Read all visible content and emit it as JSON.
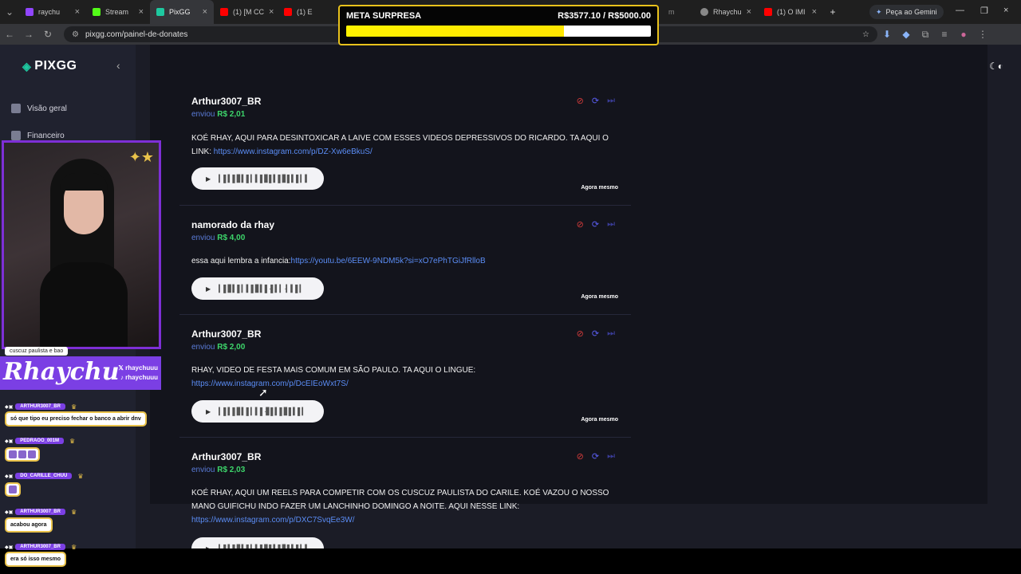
{
  "browser": {
    "tabs": [
      {
        "label": "raychu",
        "color": "#9146ff"
      },
      {
        "label": "Stream",
        "color": "#53fc18"
      },
      {
        "label": "PixGG",
        "color": "#1ec8a0"
      },
      {
        "label": "(1) [M CC",
        "color": "#ff0000"
      },
      {
        "label": "(1) E",
        "color": "#ff0000"
      },
      {
        "label": "Rhaychu",
        "color": "#888888"
      },
      {
        "label": "(1) O IMI",
        "color": "#ff0000"
      }
    ],
    "url": "pixgg.com/painel-de-donates",
    "gemini_label": "Peça ao Gemini"
  },
  "goal": {
    "title": "META SURPRESA",
    "amount_text": "R$3577.10 / R$5000.00",
    "progress": 0.7154
  },
  "app": {
    "logo": "PIXGG",
    "nav": [
      {
        "label": "Visão geral"
      },
      {
        "label": "Financeiro"
      }
    ]
  },
  "donations": [
    {
      "name": "Arthur3007_BR",
      "sent_label": "enviou",
      "amount": "R$ 2,01",
      "message": "KOÉ RHAY, AQUI PARA DESINTOXICAR A LAIVE COM ESSES VIDEOS DEPRESSIVOS DO RICARDO. TA AQUI O LINK: ",
      "link": "https://www.instagram.com/p/DZ-Xw6eBkuS/",
      "waveform": "▎▌▍▌▋▍▌▎▍▌▋▌▍▌▋▌▍▌▎▍",
      "time": "Agora mesmo"
    },
    {
      "name": "namorado da rhay",
      "sent_label": "enviou",
      "amount": "R$ 4,00",
      "message": "essa aqui lembra a infancia:",
      "link": "https://youtu.be/6EEW-9NDM5k?si=xO7ePhTGiJfRlloB",
      "waveform": "▎▌▋▍▌▎▍▌▋▍▌·▌▍▎·▎▍▌▎",
      "time": "Agora mesmo"
    },
    {
      "name": "Arthur3007_BR",
      "sent_label": "enviou",
      "amount": "R$ 2,00",
      "message": "RHAY, VIDEO DE FESTA MAIS COMUM EM SÃO PAULO. TA AQUI O LINGUE: ",
      "link": "https://www.instagram.com/p/DcEIEoWxt7S/",
      "waveform": "▎▌▍▌▋▍▌▎▍▌·▋▌▍▌▋▌▍▌▎",
      "time": "Agora mesmo"
    },
    {
      "name": "Arthur3007_BR",
      "sent_label": "enviou",
      "amount": "R$ 2,03",
      "message": "KOÉ RHAY, AQUI UM REELS PARA COMPETIR COM OS CUSCUZ PAULISTA DO CARILE. KOÉ VAZOU O NOSSO MANO GUIFICHU INDO FAZER UM LANCHINHO DOMINGO A NOITE. AQUI NESSE LINK: ",
      "link": "https://www.instagram.com/p/DXC7SvqEe3W/",
      "waveform": "▎▌▍▌▋▍▌▎▍▌▋▌▍▌▋▌▍▌▎▍",
      "time": ""
    }
  ],
  "stream_overlay": {
    "brand_name": "Rhaychu",
    "handle_x": "rhaychuuu",
    "handle_tiktok": "rhaychuuu",
    "top_pill": "cuscuz paulista e bao",
    "chat": [
      {
        "user": "ARTHUR3007_BR",
        "message": "só que tipo eu preciso fechar o banco a abrir dnv"
      },
      {
        "user": "PEDRAOO_001M",
        "message": ""
      },
      {
        "user": "DO_CARILLE_CHUU",
        "message": ""
      },
      {
        "user": "ARTHUR3007_BR",
        "message": "acabou agora"
      },
      {
        "user": "ARTHUR3007_BR",
        "message": "era só isso mesmo"
      }
    ]
  }
}
